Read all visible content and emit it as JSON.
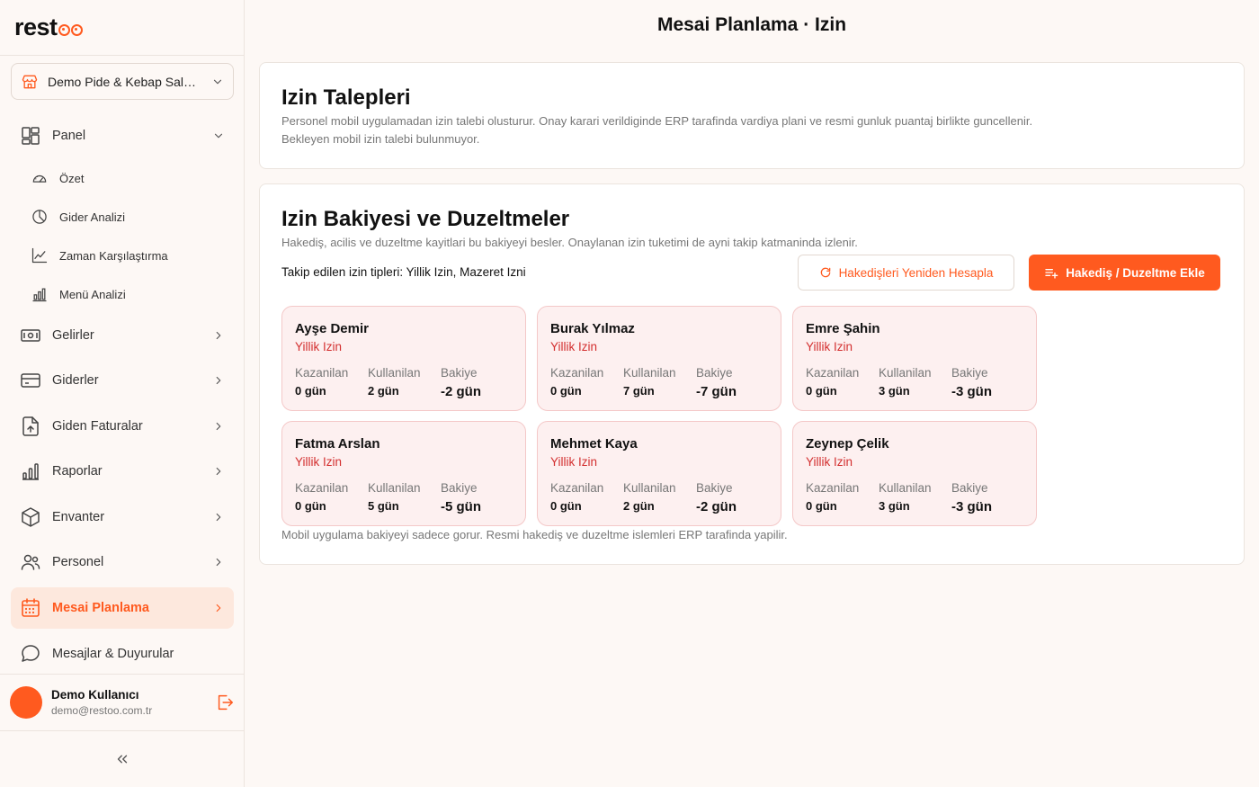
{
  "app": {
    "logo_text": "restoo",
    "store_name": "Demo Pide & Kebap Salon...",
    "page_title": "Mesai Planlama · Izin"
  },
  "sidebar": {
    "panel": {
      "label": "Panel",
      "sub_items": [
        "Özet",
        "Gider Analizi",
        "Zaman Karşılaştırma",
        "Menü Analizi"
      ]
    },
    "items": [
      {
        "label": "Gelirler"
      },
      {
        "label": "Giderler"
      },
      {
        "label": "Giden Faturalar"
      },
      {
        "label": "Raporlar"
      },
      {
        "label": "Envanter"
      },
      {
        "label": "Personel"
      },
      {
        "label": "Mesai Planlama"
      },
      {
        "label": "Mesajlar & Duyurular"
      }
    ],
    "accent_color": "#ff5a1f"
  },
  "user": {
    "name": "Demo Kullanıcı",
    "email": "demo@restoo.com.tr"
  },
  "leave_requests": {
    "title": "Izin Talepleri",
    "description": "Personel mobil uygulamadan izin talebi olusturur. Onay karari verildiginde ERP tarafinda vardiya plani ve resmi gunluk puantaj birlikte guncellenir.",
    "empty_text": "Bekleyen mobil izin talebi bulunmuyor."
  },
  "balance": {
    "title": "Izin Bakiyesi ve Duzeltmeler",
    "description": "Hakediş, acilis ve duzeltme kayitlari bu bakiyeyi besler. Onaylanan izin tuketimi de ayni takip katmaninda izlenir.",
    "tracked_types": "Takip edilen izin tipleri: Yillik Izin, Mazeret Izni",
    "recalc_button": "Hakedişleri Yeniden Hesapla",
    "add_button": "Hakediş / Duzeltme Ekle",
    "footnote": "Mobil uygulama bakiyeyi sadece gorur. Resmi hakediş ve duzeltme islemleri ERP tarafinda yapilir.",
    "labels": {
      "earned": "Kazanilan",
      "used": "Kullanilan",
      "balance": "Bakiye"
    },
    "employees": [
      {
        "name": "Ayşe Demir",
        "type": "Yillik Izin",
        "earned": "0 gün",
        "used": "2 gün",
        "balance": "-2 gün"
      },
      {
        "name": "Burak Yılmaz",
        "type": "Yillik Izin",
        "earned": "0 gün",
        "used": "7 gün",
        "balance": "-7 gün"
      },
      {
        "name": "Emre Şahin",
        "type": "Yillik Izin",
        "earned": "0 gün",
        "used": "3 gün",
        "balance": "-3 gün"
      },
      {
        "name": "Fatma Arslan",
        "type": "Yillik Izin",
        "earned": "0 gün",
        "used": "5 gün",
        "balance": "-5 gün"
      },
      {
        "name": "Mehmet Kaya",
        "type": "Yillik Izin",
        "earned": "0 gün",
        "used": "2 gün",
        "balance": "-2 gün"
      },
      {
        "name": "Zeynep Çelik",
        "type": "Yillik Izin",
        "earned": "0 gün",
        "used": "3 gün",
        "balance": "-3 gün"
      }
    ]
  }
}
